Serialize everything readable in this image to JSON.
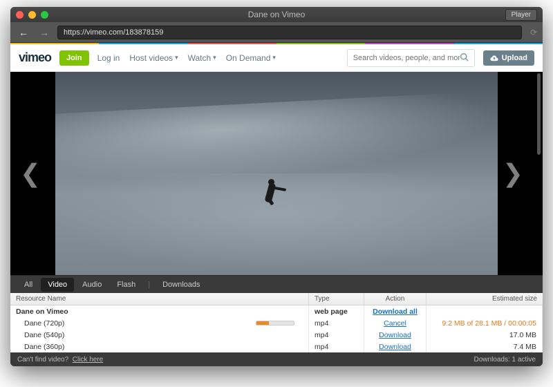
{
  "window": {
    "title": "Dane on Vimeo",
    "player_button": "Player"
  },
  "toolbar": {
    "url": "https://vimeo.com/183878159"
  },
  "color_strip": [
    "#f7b500",
    "#00adef",
    "#ff4d4d",
    "#7fc400",
    "#c642cc",
    "#00adef"
  ],
  "site": {
    "logo": "vimeo",
    "join": "Join",
    "links": [
      "Log in",
      "Host videos",
      "Watch",
      "On Demand"
    ],
    "has_caret": [
      false,
      true,
      true,
      true
    ],
    "search_placeholder": "Search videos, people, and more",
    "upload": "Upload"
  },
  "tabs_row": {
    "items": [
      "All",
      "Video",
      "Audio",
      "Flash"
    ],
    "downloads": "Downloads",
    "active_index": 1
  },
  "table": {
    "headers": {
      "name": "Resource Name",
      "type": "Type",
      "action": "Action",
      "size": "Estimated size"
    },
    "group_title": "Dane on Vimeo",
    "group_type": "web page",
    "group_action": "Download all",
    "rows": [
      {
        "name": "Dane (720p)",
        "type": "mp4",
        "action": "Cancel",
        "size": "9.2 MB of 28.1 MB / 00:00:05",
        "progress": 33,
        "orange": true
      },
      {
        "name": "Dane (540p)",
        "type": "mp4",
        "action": "Download",
        "size": "17.0 MB"
      },
      {
        "name": "Dane (360p)",
        "type": "mp4",
        "action": "Download",
        "size": "7.4 MB"
      }
    ]
  },
  "footer": {
    "left_text": "Can't find video?",
    "left_link": "Click here",
    "right": "Downloads: 1 active"
  }
}
